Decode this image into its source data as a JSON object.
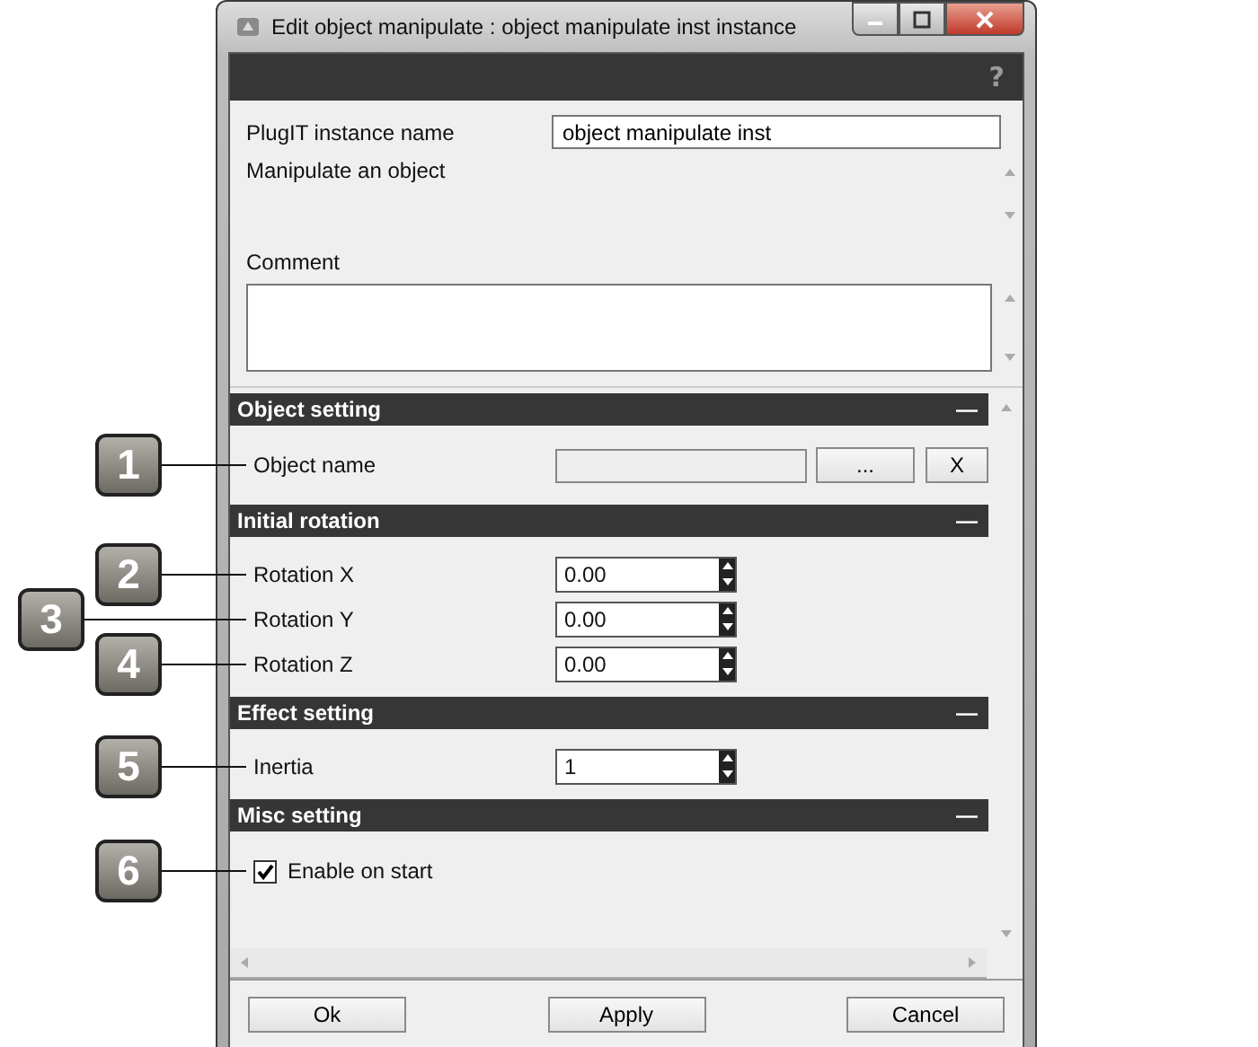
{
  "window": {
    "title": "Edit object manipulate : object manipulate inst instance"
  },
  "help": "?",
  "instance_name": {
    "label": "PlugIT instance name",
    "value": "object manipulate inst"
  },
  "description": "Manipulate an object",
  "comment": {
    "label": "Comment"
  },
  "sections": [
    {
      "title": "Object setting",
      "collapse": "—",
      "rows": [
        {
          "kind": "object",
          "label": "Object name",
          "callout": {
            "number": "1",
            "kind": "near"
          },
          "browse": "...",
          "clear": "X"
        }
      ]
    },
    {
      "title": "Initial rotation",
      "collapse": "—",
      "rows": [
        {
          "kind": "spin",
          "label": "Rotation X",
          "value": "0.00",
          "callout": {
            "number": "2",
            "kind": "near"
          }
        },
        {
          "kind": "spin",
          "label": "Rotation Y",
          "value": "0.00",
          "callout": {
            "number": "3",
            "kind": "far"
          }
        },
        {
          "kind": "spin",
          "label": "Rotation Z",
          "value": "0.00",
          "callout": {
            "number": "4",
            "kind": "near"
          }
        }
      ]
    },
    {
      "title": "Effect setting",
      "collapse": "—",
      "rows": [
        {
          "kind": "spin",
          "label": "Inertia",
          "value": "1",
          "callout": {
            "number": "5",
            "kind": "near"
          }
        }
      ]
    },
    {
      "title": "Misc setting",
      "collapse": "—",
      "rows": [
        {
          "kind": "checkbox",
          "label": "Enable on start",
          "checked": true,
          "callout": {
            "number": "6",
            "kind": "near"
          }
        }
      ]
    }
  ],
  "buttons": [
    "Ok",
    "Apply",
    "Cancel"
  ]
}
